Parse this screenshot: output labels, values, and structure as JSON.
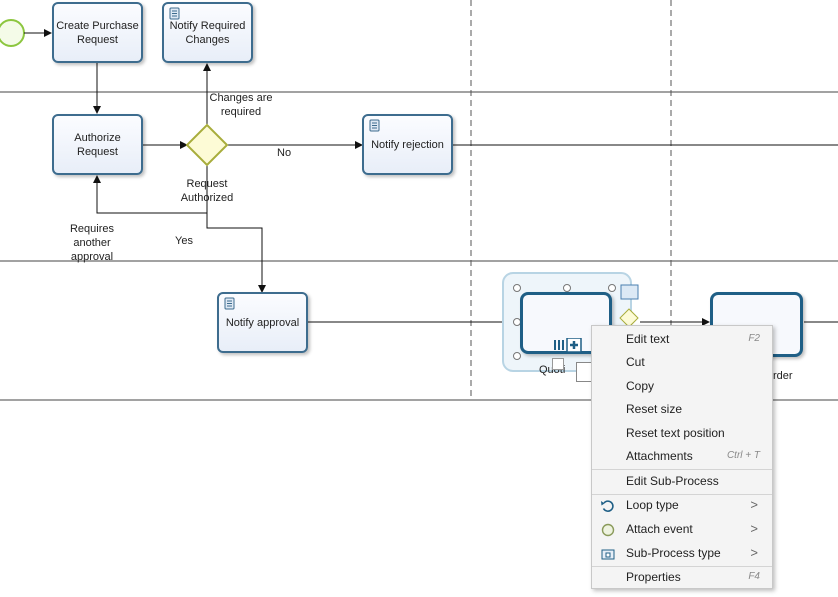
{
  "diagram": {
    "tasks": {
      "create_purchase_request": "Create Purchase Request",
      "notify_required_changes": "Notify Required Changes",
      "authorize_request": "Authorize Request",
      "notify_rejection": "Notify rejection",
      "notify_approval": "Notify approval",
      "subprocess_partial": "Quoti",
      "order_partial": "rder"
    },
    "labels": {
      "changes_required": "Changes are required",
      "no": "No",
      "request_authorized": "Request Authorized",
      "requires_another_approval": "Requires another approval",
      "yes": "Yes"
    },
    "colors": {
      "task_border": "#3d6c8e",
      "gateway_fill": "#fdfbd6",
      "gateway_border": "#a8ad3c",
      "start_event": "#8cc63f",
      "selection": "#b8d4e4"
    }
  },
  "context_menu": {
    "items": [
      {
        "label": "Edit text",
        "shortcut": "F2"
      },
      {
        "label": "Cut",
        "shortcut": ""
      },
      {
        "label": "Copy",
        "shortcut": ""
      },
      {
        "label": "Reset size",
        "shortcut": ""
      },
      {
        "label": "Reset text position",
        "shortcut": ""
      },
      {
        "label": "Attachments",
        "shortcut": "Ctrl + T"
      },
      {
        "label": "Edit Sub-Process",
        "shortcut": ""
      },
      {
        "label": "Loop type",
        "icon": "loop-icon"
      },
      {
        "label": "Attach event",
        "icon": "event-icon"
      },
      {
        "label": "Sub-Process type",
        "icon": "subprocess-icon"
      },
      {
        "label": "Properties",
        "shortcut": "F4"
      }
    ],
    "submenu_glyph": ">"
  }
}
